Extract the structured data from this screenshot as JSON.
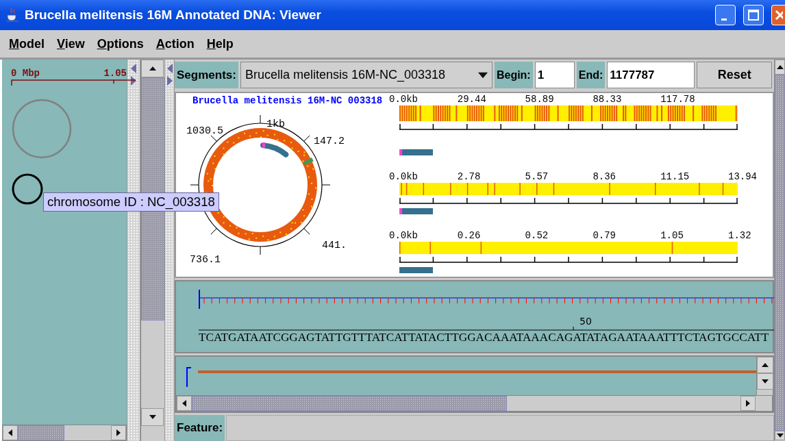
{
  "window": {
    "title": "Brucella melitensis 16M Annotated DNA: Viewer"
  },
  "menu": [
    "Model",
    "View",
    "Options",
    "Action",
    "Help"
  ],
  "overview": {
    "scale_start": "0 Mbp",
    "scale_end": "1.05",
    "tooltip": "chromosome ID : NC_003318",
    "chromosomes": [
      {
        "selected": false
      },
      {
        "selected": true
      }
    ]
  },
  "toolbar": {
    "segments_label": "Segments:",
    "segment": "Brucella melitensis 16M-NC_003318",
    "begin_label": "Begin:",
    "begin": "1",
    "end_label": "End:",
    "end": "1177787",
    "reset": "Reset"
  },
  "map": {
    "title": "Brucella melitensis 16M-NC 003318",
    "circle_labels": [
      "1kb",
      "147.2",
      "441.",
      "736.1",
      "1030.5"
    ],
    "tracks": [
      {
        "kind": "dense",
        "highlight": true,
        "labels": [
          "0.0kb",
          "29.44",
          "58.89",
          "88.33",
          "117.78"
        ]
      },
      {
        "kind": "sparse",
        "highlight": true,
        "labels": [
          "0.0kb",
          "2.78",
          "5.57",
          "8.36",
          "11.15",
          "13.94"
        ]
      },
      {
        "kind": "sparse",
        "highlight": false,
        "labels": [
          "0.0kb",
          "0.26",
          "0.52",
          "0.79",
          "1.05",
          "1.32"
        ]
      }
    ]
  },
  "sequence": {
    "ruler_label": "50",
    "bases": "TCATGATAATCGGAGTATTGTTTATCATTATACTTGGACAAATAAACAGATATAGAATAAATTTCTAGTGCCATT"
  },
  "feature": {
    "label": "Feature:"
  }
}
